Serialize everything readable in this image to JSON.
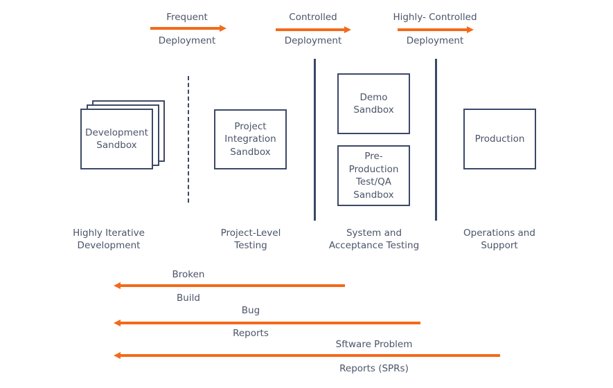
{
  "colors": {
    "arrow": "#f26a1b",
    "line": "#3b4866",
    "text": "#4a5468"
  },
  "forward_arrows": [
    {
      "label_top": "Frequent",
      "label_bottom": "Deployment",
      "direction": "right"
    },
    {
      "label_top": "Controlled",
      "label_bottom": "Deployment",
      "direction": "right"
    },
    {
      "label_top": "Highly- Controlled",
      "label_bottom": "Deployment",
      "direction": "right"
    }
  ],
  "boxes": {
    "development": "Development\nSandbox",
    "integration": "Project\nIntegration\nSandbox",
    "demo": "Demo\nSandbox",
    "preproduction": "Pre-\nProduction\nTest/QA\nSandbox",
    "production": "Production"
  },
  "stages": [
    {
      "line1": "Highly Iterative",
      "line2": "Development"
    },
    {
      "line1": "Project-Level",
      "line2": "Testing"
    },
    {
      "line1": "System and",
      "line2": "Acceptance Testing"
    },
    {
      "line1": "Operations and",
      "line2": "Support"
    }
  ],
  "feedback_arrows": [
    {
      "label_top": "Broken",
      "label_bottom": "Build",
      "direction": "left"
    },
    {
      "label_top": "Bug",
      "label_bottom": "Reports",
      "direction": "left"
    },
    {
      "label_top": "Sftware Problem",
      "label_bottom": "Reports (SPRs)",
      "direction": "left"
    }
  ]
}
